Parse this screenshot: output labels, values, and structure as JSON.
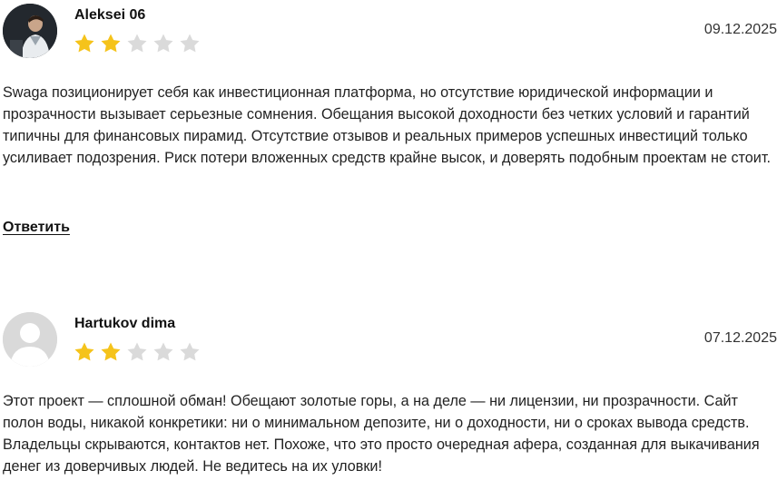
{
  "colors": {
    "star_filled": "#F5C31B",
    "star_empty": "#DADADA",
    "text": "#222222",
    "date": "#333333"
  },
  "reviews": [
    {
      "author": "Aleksei 06",
      "date": "09.12.2025",
      "rating": 2,
      "rating_max": 5,
      "avatar": "user-photo",
      "text": "Swaga позиционирует себя как инвестиционная платформа, но отсутствие юридической информации и прозрачности вызывает серьезные сомнения. Обещания высокой доходности без четких условий и гарантий типичны для финансовых пирамид. Отсутствие отзывов и реальных примеров успешных инвестиций только усиливает подозрения. Риск потери вложенных средств крайне высок, и доверять подобным проектам не стоит.",
      "reply_label": "Ответить"
    },
    {
      "author": "Hartukov dima",
      "date": "07.12.2025",
      "rating": 2,
      "rating_max": 5,
      "avatar": "default-user-icon",
      "text": "Этот проект — сплошной обман! Обещают золотые горы, а на деле — ни лицензии, ни прозрачности. Сайт полон воды, никакой конкретики: ни о минимальном депозите, ни о доходности, ни о сроках вывода средств. Владельцы скрываются, контактов нет. Похоже, что это просто очередная афера, созданная для выкачивания денег из доверчивых людей. Не ведитесь на их уловки!"
    }
  ]
}
